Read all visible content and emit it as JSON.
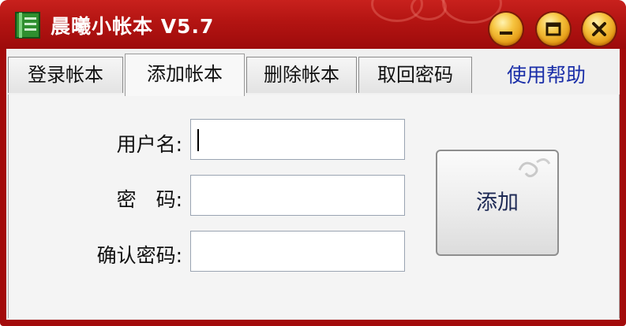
{
  "window": {
    "title": "晨曦小帐本 V5.7",
    "controls": {
      "minimize_icon": "minimize-icon",
      "maximize_icon": "maximize-icon",
      "close_icon": "close-icon"
    },
    "colors": {
      "titlebar": "#b31412",
      "button_gold": "#f6c440"
    }
  },
  "tabs": [
    {
      "label": "登录帐本",
      "active": false
    },
    {
      "label": "添加帐本",
      "active": true
    },
    {
      "label": "删除帐本",
      "active": false
    },
    {
      "label": "取回密码",
      "active": false
    }
  ],
  "help_link": "使用帮助",
  "form": {
    "username_label": "用户名:",
    "username_value": "",
    "password_label": "密　码:",
    "password_value": "",
    "confirm_label": "确认密码:",
    "confirm_value": ""
  },
  "add_button": "添加"
}
